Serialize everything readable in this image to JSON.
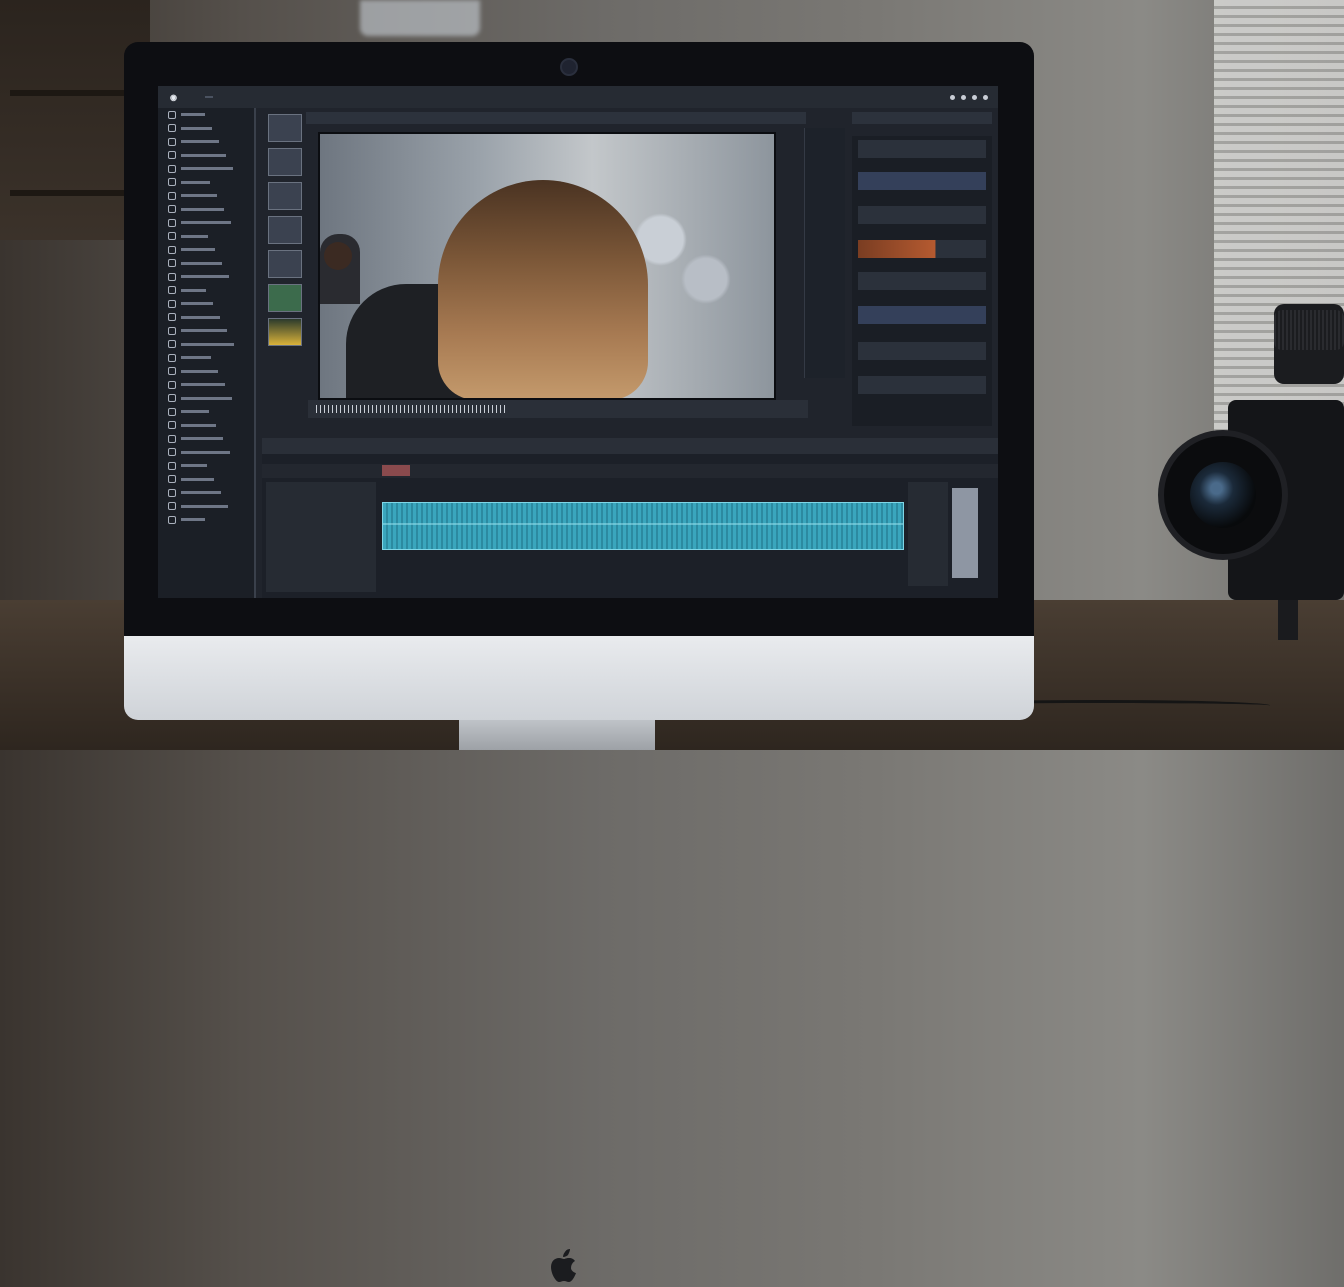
{
  "scene": {
    "description_colors": {
      "accent": "#3aa6bd",
      "clip_highlight": "#7fd6e6",
      "marker_red": "#8a4a4d",
      "inspector_orange": "#b55a30"
    }
  },
  "menubar": {
    "items": [],
    "tray_icons": [
      "wifi-icon",
      "bluetooth-icon",
      "battery-icon",
      "clock-icon"
    ]
  },
  "left_panel": {
    "items": [
      "",
      "",
      "",
      "",
      "",
      "",
      "",
      "",
      "",
      "",
      "",
      "",
      "",
      "",
      "",
      "",
      "",
      "",
      "",
      "",
      "",
      "",
      "",
      "",
      "",
      "",
      "",
      "",
      "",
      "",
      ""
    ]
  },
  "timeline": {
    "clip_present": true
  }
}
